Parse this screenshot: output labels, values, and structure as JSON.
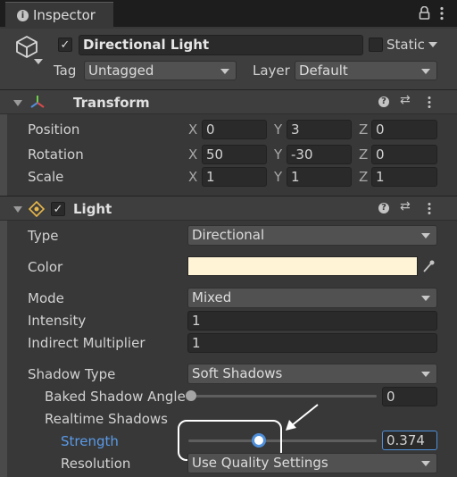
{
  "tab": {
    "title": "Inspector",
    "info_icon": "info-icon",
    "lock_icon": "lock-icon",
    "menu_icon": "kebab-menu-icon"
  },
  "gameobject": {
    "icon": "cube-icon",
    "active": true,
    "name": "Directional Light",
    "static_label": "Static",
    "tag_label": "Tag",
    "tag_value": "Untagged",
    "layer_label": "Layer",
    "layer_value": "Default"
  },
  "transform": {
    "title": "Transform",
    "icon": "transform-axes-icon",
    "rows": [
      {
        "label": "Position",
        "x": "0",
        "y": "3",
        "z": "0"
      },
      {
        "label": "Rotation",
        "x": "50",
        "y": "-30",
        "z": "0"
      },
      {
        "label": "Scale",
        "x": "1",
        "y": "1",
        "z": "1"
      }
    ],
    "axis_x": "X",
    "axis_y": "Y",
    "axis_z": "Z"
  },
  "light": {
    "title": "Light",
    "enabled": true,
    "icon": "light-icon",
    "type_label": "Type",
    "type_value": "Directional",
    "color_label": "Color",
    "color_value": "#fff4d6",
    "mode_label": "Mode",
    "mode_value": "Mixed",
    "intensity_label": "Intensity",
    "intensity_value": "1",
    "indirect_label": "Indirect Multiplier",
    "indirect_value": "1",
    "shadow_type_label": "Shadow Type",
    "shadow_type_value": "Soft Shadows",
    "baked_angle_label": "Baked Shadow Angle",
    "baked_angle_value": "0",
    "baked_angle_fraction": 0,
    "realtime_label": "Realtime Shadows",
    "strength_label": "Strength",
    "strength_value": "0.374",
    "strength_fraction": 0.374,
    "resolution_label": "Resolution",
    "resolution_value": "Use Quality Settings"
  },
  "colors": {
    "accent": "#4f8fd9",
    "background": "#383838",
    "highlight_label": "#5a9ae8"
  }
}
